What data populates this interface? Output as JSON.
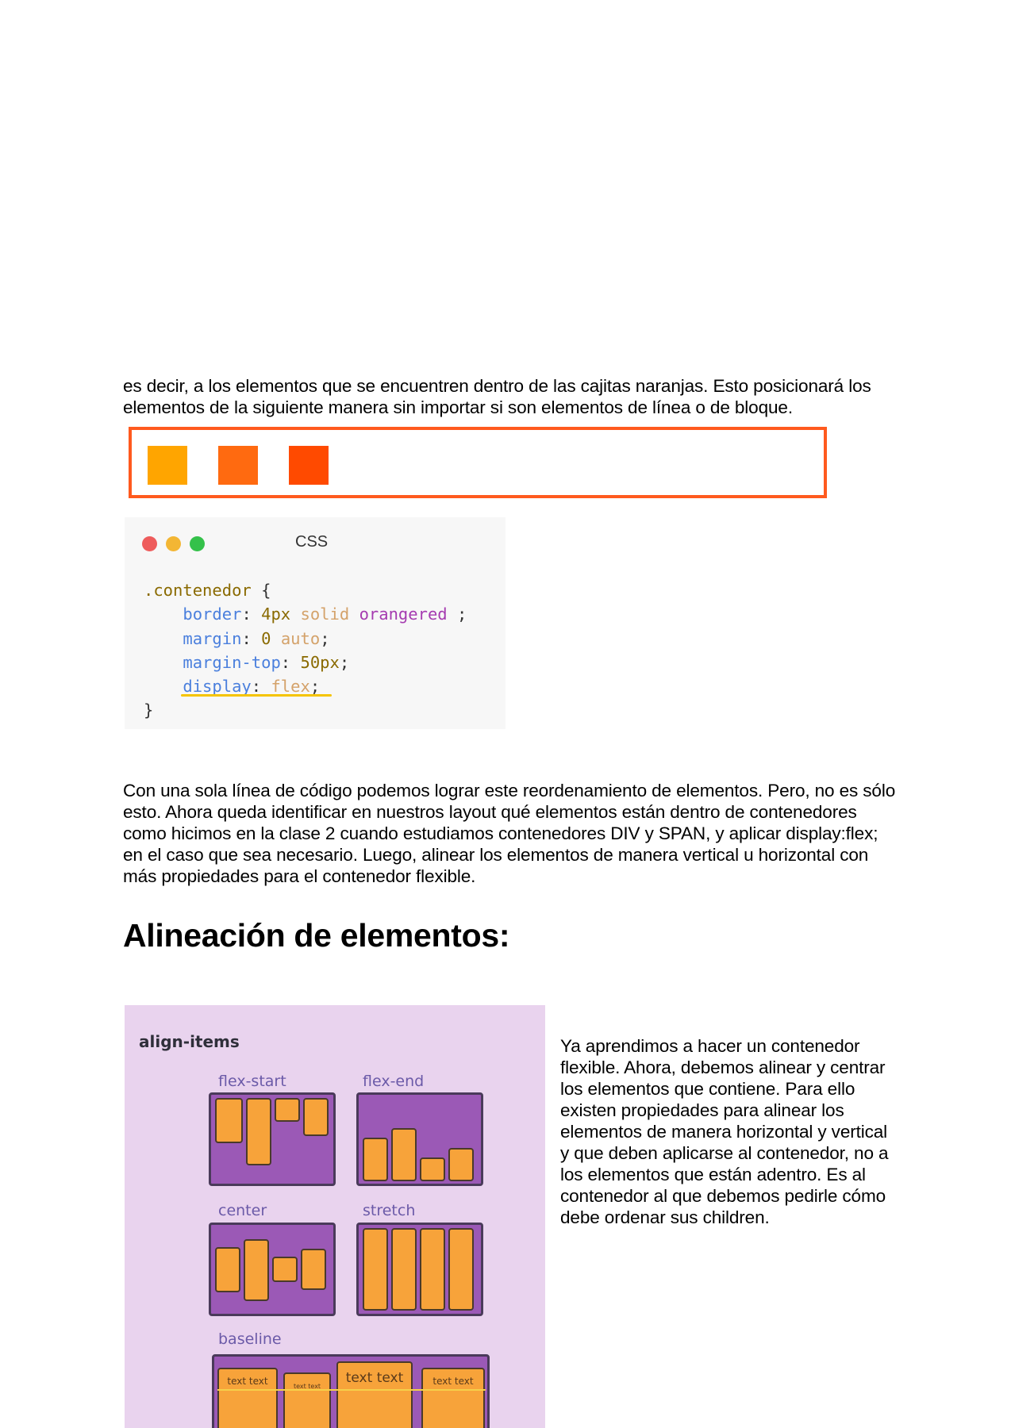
{
  "intro_paragraph": "es decir, a los elementos que se encuentren dentro de las cajitas naranjas. Esto posicionará los elementos de la siguiente manera sin importar si son elementos de línea o de bloque.",
  "demo": {
    "border_color": "#ff5a1e",
    "square_colors": [
      "#ffa500",
      "#ff6a10",
      "#ff4a00"
    ]
  },
  "code_block": {
    "language": "CSS",
    "window_dots": [
      "#ee5c5c",
      "#f3b634",
      "#34c14a"
    ],
    "lines": [
      ".contenedor {",
      "border: 4px solid orangered ;",
      "margin: 0 auto;",
      "margin-top: 50px;",
      "display: flex;",
      "}"
    ]
  },
  "paragraph_2": "Con una sola línea de código podemos lograr este reordenamiento de elementos. Pero, no es sólo esto. Ahora queda identificar en nuestros layout qué elementos están dentro de contenedores como hicimos en la clase 2 cuando estudiamos contenedores DIV y SPAN, y aplicar display:flex; en el caso que sea necesario. Luego, alinear los elementos de manera vertical u horizontal con más propiedades para el contenedor flexible.",
  "heading": "Alineación de elementos:",
  "figure": {
    "title": "align-items",
    "labels": {
      "flex_start": "flex-start",
      "flex_end": "flex-end",
      "center": "center",
      "stretch": "stretch",
      "baseline": "baseline"
    },
    "baseline_items": [
      "text text",
      "text text",
      "text text",
      "text text"
    ]
  },
  "paragraph_3": "Ya aprendimos a hacer un contenedor flexible. Ahora, debemos alinear y centrar los elementos que contiene. Para ello existen propiedades para alinear los elementos de manera horizontal y vertical y que deben aplicarse al contenedor, no a los elementos que están adentro. Es al contenedor al que debemos pedirle cómo debe ordenar sus children."
}
